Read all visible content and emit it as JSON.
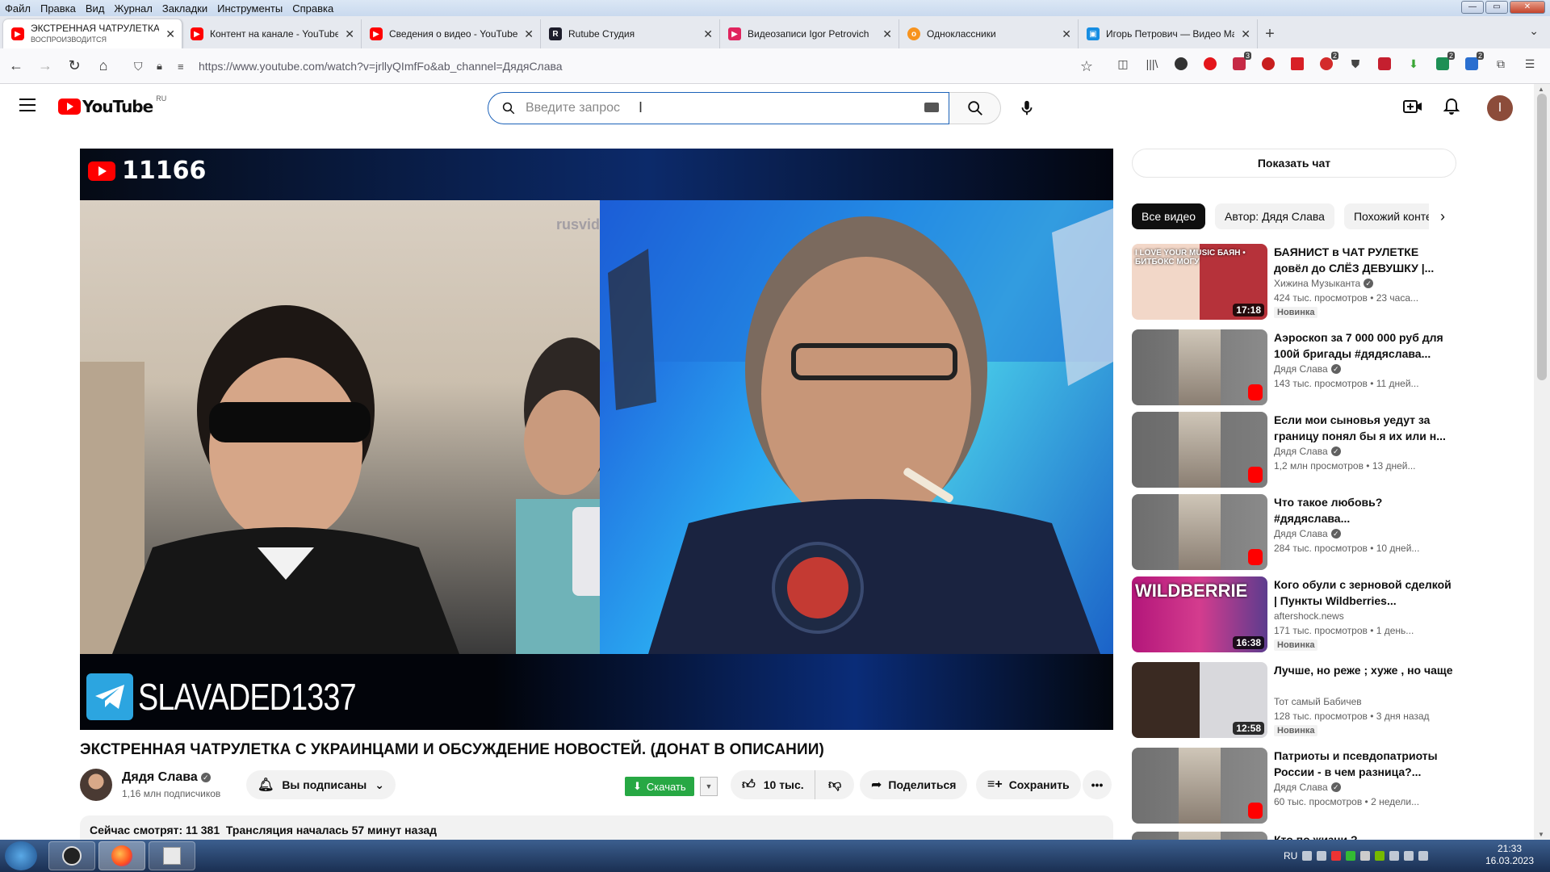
{
  "menu": [
    "Файл",
    "Правка",
    "Вид",
    "Журнал",
    "Закладки",
    "Инструменты",
    "Справка"
  ],
  "tabs": [
    {
      "title": "ЭКСТРЕННАЯ ЧАТРУЛЕТКА С УКР",
      "subtitle": "ВОСПРОИЗВОДИТСЯ",
      "icon": "youtube-icon"
    },
    {
      "title": "Контент на канале - YouTube Studio",
      "icon": "youtube-icon"
    },
    {
      "title": "Сведения о видео - YouTube Studio",
      "icon": "youtube-icon"
    },
    {
      "title": "Rutube Студия",
      "icon": "rutube-icon"
    },
    {
      "title": "Видеозаписи Igor Petrovich",
      "icon": "vk-video-icon"
    },
    {
      "title": "Одноклассники",
      "icon": "ok-icon"
    },
    {
      "title": "Игорь Петрович — Видео Mail.ru",
      "icon": "mail-video-icon"
    }
  ],
  "url": "https://www.youtube.com/watch?v=jrllyQImfFo&ab_channel=ДядяСлава",
  "extension_badges": [
    "3",
    "2",
    "2",
    "2"
  ],
  "youtube": {
    "logo_text": "YouTube",
    "country_code": "RU",
    "search_placeholder": "Введите запрос"
  },
  "video": {
    "viewer_counter": "11166",
    "watermark": "rusvid",
    "telegram_handle": "SLAVADED1337",
    "title": "ЭКСТРЕННАЯ ЧАТРУЛЕТКА С УКРАИНЦАМИ И ОБСУЖДЕНИЕ НОВОСТЕЙ. (ДОНАТ В ОПИСАНИИ)",
    "channel": "Дядя Слава",
    "subscribers": "1,16 млн подписчиков",
    "subscribed_label": "Вы подписаны",
    "download_label": "Скачать",
    "likes": "10 тыс.",
    "share_label": "Поделиться",
    "save_label": "Сохранить",
    "watching_now": "Сейчас смотрят: 11 381",
    "stream_started": "Трансляция началась 57 минут назад"
  },
  "sidebar": {
    "show_chat": "Показать чат",
    "chips": [
      "Все видео",
      "Автор: Дядя Слава",
      "Похожий контент"
    ],
    "recommendations": [
      {
        "title": "БАЯНИСТ в ЧАТ РУЛЕТКЕ довёл до СЛЁЗ ДЕВУШКУ |...",
        "channel": "Хижина Музыканта",
        "verified": true,
        "meta": "424 тыс. просмотров • 23 часа...",
        "duration": "17:18",
        "badge": "Новинка",
        "thumb_text": "I LOVE YOUR MUSIC  БАЯН • БИТБОКС МОГУ"
      },
      {
        "title": "Аэроскоп за 7 000 000 руб для 100й бригады #дядяслава...",
        "channel": "Дядя Слава",
        "verified": true,
        "meta": "143 тыс. просмотров • 11 дней...",
        "duration": "",
        "badge": "",
        "thumb_text": ""
      },
      {
        "title": "Если мои сыновья уедут за границу понял бы я их или н...",
        "channel": "Дядя Слава",
        "verified": true,
        "meta": "1,2 млн просмотров • 13 дней...",
        "duration": "",
        "badge": "",
        "thumb_text": ""
      },
      {
        "title": "Что такое любовь? #дядяслава...",
        "channel": "Дядя Слава",
        "verified": true,
        "meta": "284 тыс. просмотров • 10 дней...",
        "duration": "",
        "badge": "",
        "thumb_text": ""
      },
      {
        "title": "Кого обули с зерновой сделкой | Пункты Wildberries...",
        "channel": "aftershock.news",
        "verified": false,
        "meta": "171 тыс. просмотров • 1 день...",
        "duration": "16:38",
        "badge": "Новинка",
        "thumb_text": "WILDBERRIE"
      },
      {
        "title": "Лучше, но реже ; хуже , но чаще",
        "channel": "Тот самый Бабичев",
        "verified": false,
        "meta": "128 тыс. просмотров • 3 дня назад",
        "duration": "12:58",
        "badge": "Новинка",
        "thumb_text": ""
      },
      {
        "title": "Патриоты и псевдопатриоты России - в чем разница?...",
        "channel": "Дядя Слава",
        "verified": true,
        "meta": "60 тыс. просмотров • 2 недели...",
        "duration": "",
        "badge": "",
        "thumb_text": ""
      },
      {
        "title": "Кто по жизни ?",
        "channel": "",
        "verified": false,
        "meta": "",
        "duration": "",
        "badge": "",
        "thumb_text": ""
      }
    ]
  },
  "taskbar": {
    "lang": "RU",
    "time": "21:33",
    "date": "16.03.2023"
  },
  "colors": {
    "youtube_red": "#ff0000",
    "download_green": "#27a844",
    "search_focus": "#1c62b9"
  }
}
